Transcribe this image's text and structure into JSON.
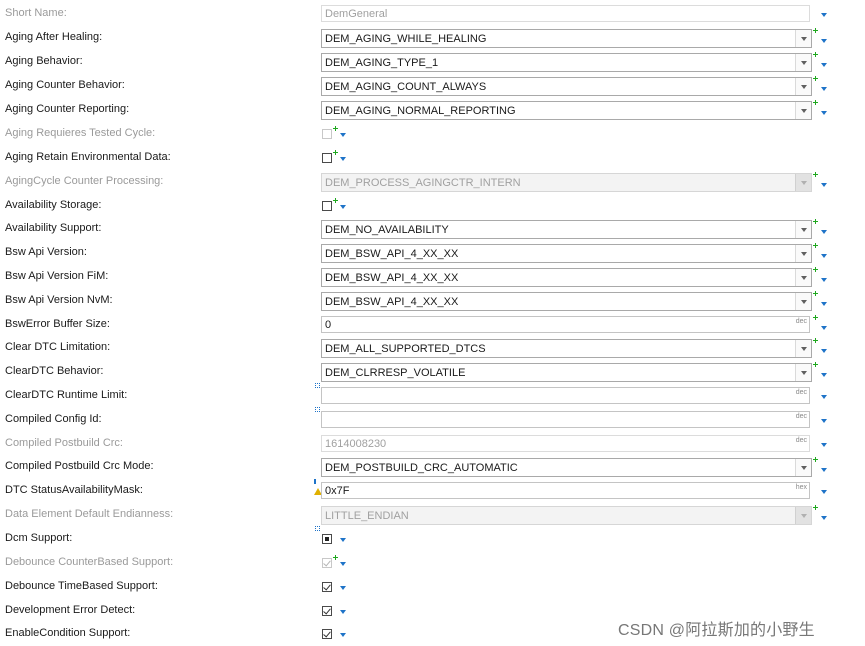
{
  "rows": [
    {
      "label": "Short Name:",
      "type": "text",
      "value": "DemGeneral",
      "disabled": true
    },
    {
      "label": "Aging After Healing:",
      "type": "combo",
      "value": "DEM_AGING_WHILE_HEALING"
    },
    {
      "label": "Aging Behavior:",
      "type": "combo",
      "value": "DEM_AGING_TYPE_1"
    },
    {
      "label": "Aging Counter Behavior:",
      "type": "combo",
      "value": "DEM_AGING_COUNT_ALWAYS"
    },
    {
      "label": "Aging Counter Reporting:",
      "type": "combo",
      "value": "DEM_AGING_NORMAL_REPORTING"
    },
    {
      "label": "Aging Requieres Tested Cycle:",
      "type": "checkbox",
      "checked": false,
      "disabled": true
    },
    {
      "label": "Aging Retain Environmental Data:",
      "type": "checkbox",
      "checked": false
    },
    {
      "label": "AgingCycle Counter Processing:",
      "type": "combo",
      "value": "DEM_PROCESS_AGINGCTR_INTERN",
      "disabled": true
    },
    {
      "label": "Availability Storage:",
      "type": "checkbox",
      "checked": false
    },
    {
      "label": "Availability Support:",
      "type": "combo",
      "value": "DEM_NO_AVAILABILITY"
    },
    {
      "label": "Bsw Api Version:",
      "type": "combo",
      "value": "DEM_BSW_API_4_XX_XX"
    },
    {
      "label": "Bsw Api Version FiM:",
      "type": "combo",
      "value": "DEM_BSW_API_4_XX_XX"
    },
    {
      "label": "Bsw Api Version NvM:",
      "type": "combo",
      "value": "DEM_BSW_API_4_XX_XX"
    },
    {
      "label": "BswError Buffer Size:",
      "type": "number",
      "value": "0",
      "suffix": "dec"
    },
    {
      "label": "Clear DTC Limitation:",
      "type": "combo",
      "value": "DEM_ALL_SUPPORTED_DTCS"
    },
    {
      "label": "ClearDTC Behavior:",
      "type": "combo",
      "value": "DEM_CLRRESP_VOLATILE"
    },
    {
      "label": "ClearDTC Runtime Limit:",
      "type": "number",
      "value": "",
      "suffix": "dec"
    },
    {
      "label": "Compiled Config Id:",
      "type": "number",
      "value": "",
      "suffix": "dec"
    },
    {
      "label": "Compiled Postbuild Crc:",
      "type": "number",
      "value": "1614008230",
      "suffix": "dec",
      "disabled": true
    },
    {
      "label": "Compiled Postbuild Crc Mode:",
      "type": "combo",
      "value": "DEM_POSTBUILD_CRC_AUTOMATIC"
    },
    {
      "label": "DTC StatusAvailabilityMask:",
      "type": "number",
      "value": "0x7F",
      "suffix": "hex"
    },
    {
      "label": "Data Element Default Endianness:",
      "type": "combo",
      "value": "LITTLE_ENDIAN",
      "disabled": true
    },
    {
      "label": "Dcm Support:",
      "type": "checkbox",
      "checked": true
    },
    {
      "label": "Debounce CounterBased Support:",
      "type": "checkbox",
      "checked": true,
      "disabled": true
    },
    {
      "label": "Debounce TimeBased Support:",
      "type": "checkbox",
      "checked": true
    },
    {
      "label": "Development Error Detect:",
      "type": "checkbox",
      "checked": true
    },
    {
      "label": "EnableCondition Support:",
      "type": "checkbox",
      "checked": true
    }
  ],
  "watermark": "CSDN @阿拉斯加的小野生",
  "colors": {
    "accent": "#1e73c8",
    "modified": "#1fa81f",
    "warning": "#e0b000"
  },
  "icons": [
    "chevron-down-icon",
    "modified-star-icon",
    "dropdown-arrow-icon",
    "warning-icon"
  ]
}
